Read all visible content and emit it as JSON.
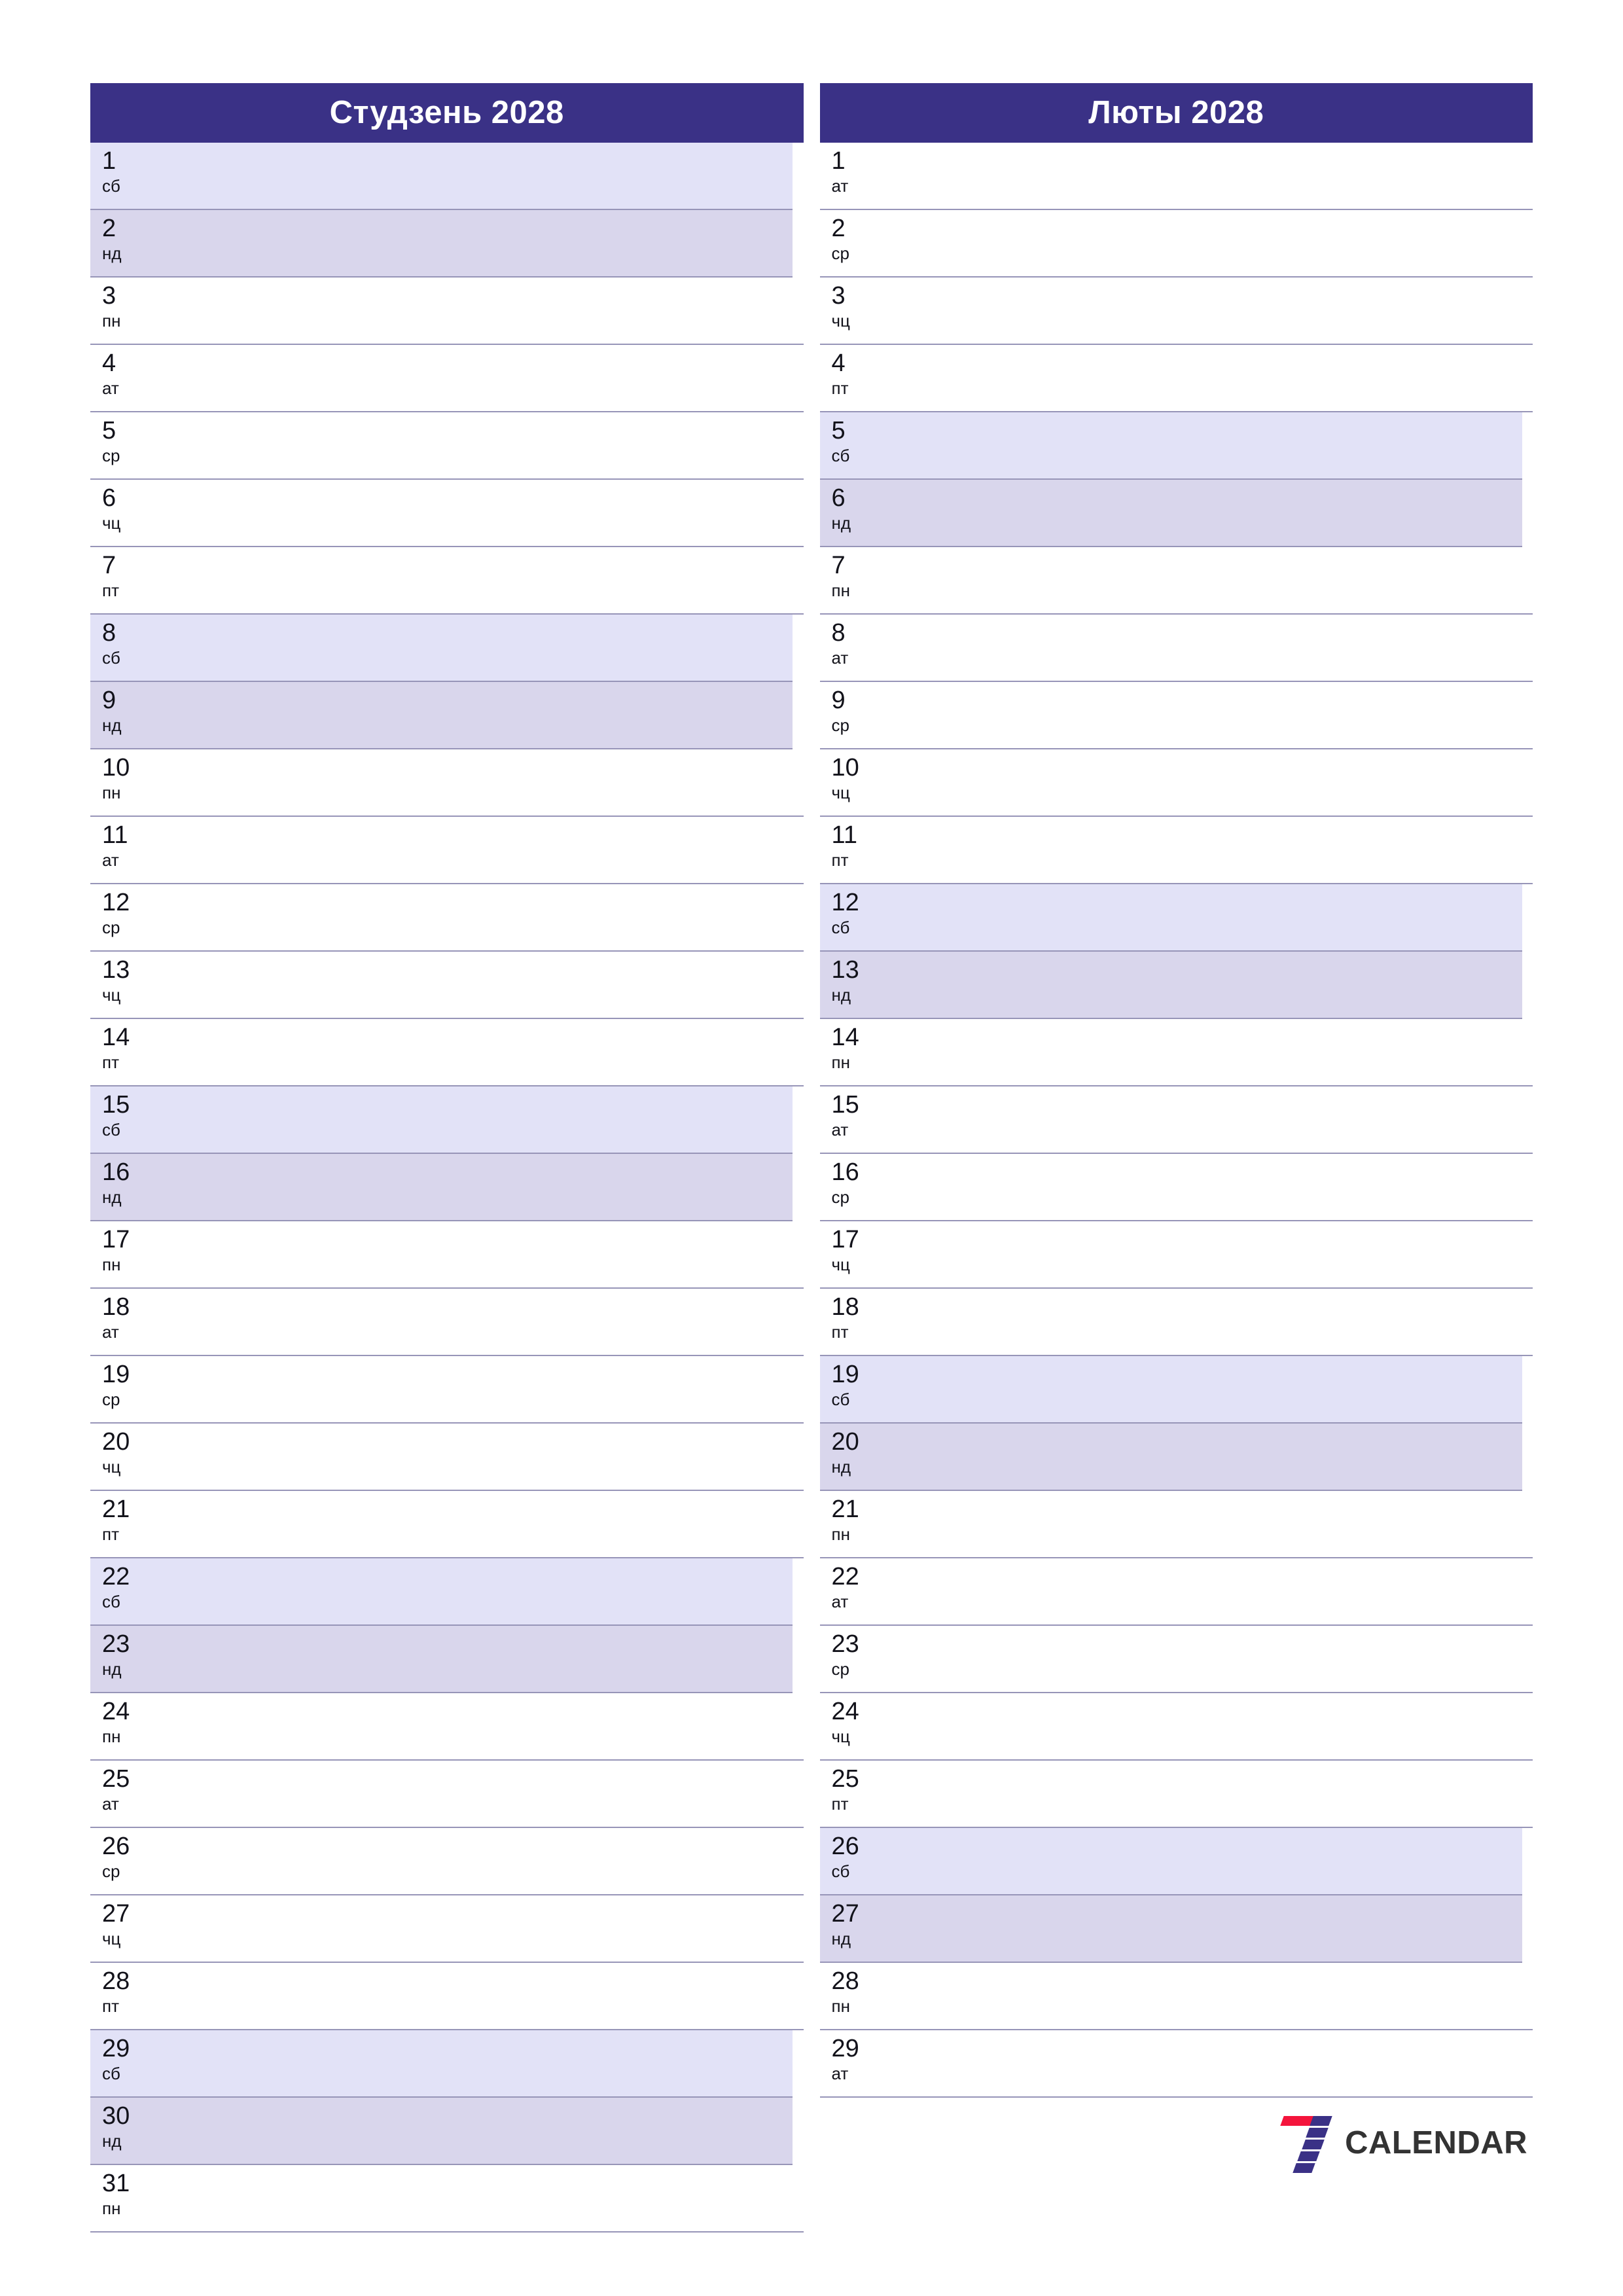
{
  "document": {
    "kind": "monthly-planner",
    "year": "2028",
    "language": "be"
  },
  "colors": {
    "header_bg": "#3A3186",
    "header_text": "#FFFFFF",
    "saturday_bg": "#E2E2F7",
    "sunday_bg": "#D9D6EC",
    "grid_line": "#9795B8",
    "page_bg": "#FFFFFF",
    "logo_red": "#F4143C",
    "logo_blue": "#3A3186",
    "logo_text": "#333333"
  },
  "brand": {
    "mark_name": "seven-calendar-logo",
    "text": "CALENDAR"
  },
  "months": [
    {
      "id": "january",
      "title": "Студзень 2028",
      "days": [
        {
          "num": "1",
          "wd": "сб",
          "type": "sat"
        },
        {
          "num": "2",
          "wd": "нд",
          "type": "sun"
        },
        {
          "num": "3",
          "wd": "пн",
          "type": "weekday"
        },
        {
          "num": "4",
          "wd": "ат",
          "type": "weekday"
        },
        {
          "num": "5",
          "wd": "ср",
          "type": "weekday"
        },
        {
          "num": "6",
          "wd": "чц",
          "type": "weekday"
        },
        {
          "num": "7",
          "wd": "пт",
          "type": "weekday"
        },
        {
          "num": "8",
          "wd": "сб",
          "type": "sat"
        },
        {
          "num": "9",
          "wd": "нд",
          "type": "sun"
        },
        {
          "num": "10",
          "wd": "пн",
          "type": "weekday"
        },
        {
          "num": "11",
          "wd": "ат",
          "type": "weekday"
        },
        {
          "num": "12",
          "wd": "ср",
          "type": "weekday"
        },
        {
          "num": "13",
          "wd": "чц",
          "type": "weekday"
        },
        {
          "num": "14",
          "wd": "пт",
          "type": "weekday"
        },
        {
          "num": "15",
          "wd": "сб",
          "type": "sat"
        },
        {
          "num": "16",
          "wd": "нд",
          "type": "sun"
        },
        {
          "num": "17",
          "wd": "пн",
          "type": "weekday"
        },
        {
          "num": "18",
          "wd": "ат",
          "type": "weekday"
        },
        {
          "num": "19",
          "wd": "ср",
          "type": "weekday"
        },
        {
          "num": "20",
          "wd": "чц",
          "type": "weekday"
        },
        {
          "num": "21",
          "wd": "пт",
          "type": "weekday"
        },
        {
          "num": "22",
          "wd": "сб",
          "type": "sat"
        },
        {
          "num": "23",
          "wd": "нд",
          "type": "sun"
        },
        {
          "num": "24",
          "wd": "пн",
          "type": "weekday"
        },
        {
          "num": "25",
          "wd": "ат",
          "type": "weekday"
        },
        {
          "num": "26",
          "wd": "ср",
          "type": "weekday"
        },
        {
          "num": "27",
          "wd": "чц",
          "type": "weekday"
        },
        {
          "num": "28",
          "wd": "пт",
          "type": "weekday"
        },
        {
          "num": "29",
          "wd": "сб",
          "type": "sat"
        },
        {
          "num": "30",
          "wd": "нд",
          "type": "sun"
        },
        {
          "num": "31",
          "wd": "пн",
          "type": "weekday"
        }
      ]
    },
    {
      "id": "february",
      "title": "Люты 2028",
      "days": [
        {
          "num": "1",
          "wd": "ат",
          "type": "weekday"
        },
        {
          "num": "2",
          "wd": "ср",
          "type": "weekday"
        },
        {
          "num": "3",
          "wd": "чц",
          "type": "weekday"
        },
        {
          "num": "4",
          "wd": "пт",
          "type": "weekday"
        },
        {
          "num": "5",
          "wd": "сб",
          "type": "sat"
        },
        {
          "num": "6",
          "wd": "нд",
          "type": "sun"
        },
        {
          "num": "7",
          "wd": "пн",
          "type": "weekday"
        },
        {
          "num": "8",
          "wd": "ат",
          "type": "weekday"
        },
        {
          "num": "9",
          "wd": "ср",
          "type": "weekday"
        },
        {
          "num": "10",
          "wd": "чц",
          "type": "weekday"
        },
        {
          "num": "11",
          "wd": "пт",
          "type": "weekday"
        },
        {
          "num": "12",
          "wd": "сб",
          "type": "sat"
        },
        {
          "num": "13",
          "wd": "нд",
          "type": "sun"
        },
        {
          "num": "14",
          "wd": "пн",
          "type": "weekday"
        },
        {
          "num": "15",
          "wd": "ат",
          "type": "weekday"
        },
        {
          "num": "16",
          "wd": "ср",
          "type": "weekday"
        },
        {
          "num": "17",
          "wd": "чц",
          "type": "weekday"
        },
        {
          "num": "18",
          "wd": "пт",
          "type": "weekday"
        },
        {
          "num": "19",
          "wd": "сб",
          "type": "sat"
        },
        {
          "num": "20",
          "wd": "нд",
          "type": "sun"
        },
        {
          "num": "21",
          "wd": "пн",
          "type": "weekday"
        },
        {
          "num": "22",
          "wd": "ат",
          "type": "weekday"
        },
        {
          "num": "23",
          "wd": "ср",
          "type": "weekday"
        },
        {
          "num": "24",
          "wd": "чц",
          "type": "weekday"
        },
        {
          "num": "25",
          "wd": "пт",
          "type": "weekday"
        },
        {
          "num": "26",
          "wd": "сб",
          "type": "sat"
        },
        {
          "num": "27",
          "wd": "нд",
          "type": "sun"
        },
        {
          "num": "28",
          "wd": "пн",
          "type": "weekday"
        },
        {
          "num": "29",
          "wd": "ат",
          "type": "weekday"
        }
      ]
    }
  ]
}
